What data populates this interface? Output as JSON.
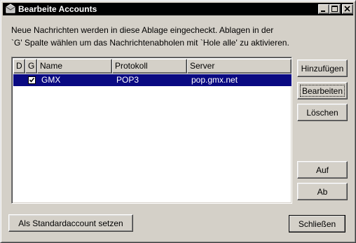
{
  "window": {
    "title": "Bearbeite Accounts",
    "icon": "mail-app-icon"
  },
  "caption_buttons": {
    "minimize": "minimize-icon",
    "maximize": "maximize-icon",
    "close": "close-icon"
  },
  "info": {
    "line1": "Neue Nachrichten werden in diese Ablage eingecheckt. Ablagen in der",
    "line2": "`G' Spalte wählen um das Nachrichtenabholen mit `Hole alle' zu aktivieren."
  },
  "table": {
    "columns": [
      "D",
      "G",
      "Name",
      "Protokoll",
      "Server"
    ],
    "rows": [
      {
        "d": "",
        "g_checked": true,
        "name": "GMX",
        "protocol": "POP3",
        "server": "pop.gmx.net"
      }
    ]
  },
  "buttons": {
    "add": "Hinzufügen",
    "edit": "Bearbeiten",
    "delete": "Löschen",
    "up": "Auf",
    "down": "Ab",
    "set_default": "Als Standardaccount setzen",
    "close": "Schließen"
  },
  "colors": {
    "selection": "#0a0a82",
    "face": "#d4d0c8",
    "titlebar": "#000000"
  }
}
